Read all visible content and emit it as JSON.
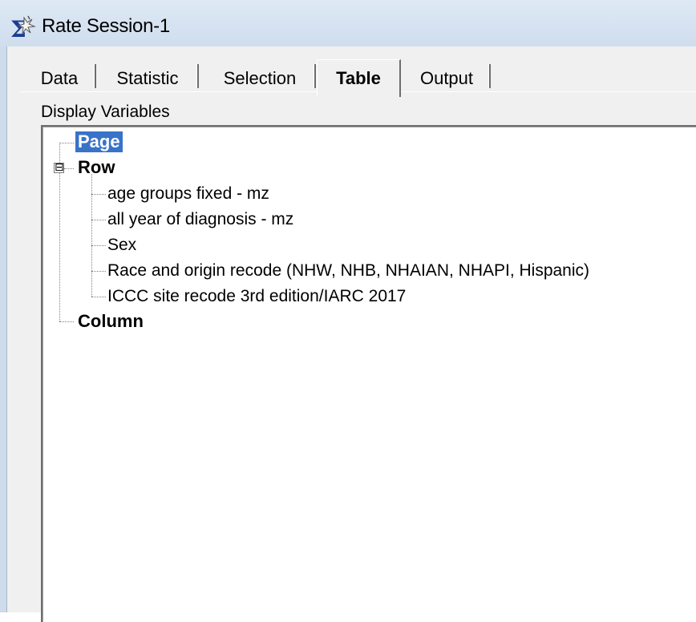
{
  "window": {
    "title": "Rate Session-1",
    "icon": "sigma-sparkle-icon"
  },
  "tabs": [
    {
      "label": "Data",
      "active": false
    },
    {
      "label": "Statistic",
      "active": false
    },
    {
      "label": "Selection",
      "active": false
    },
    {
      "label": "Table",
      "active": true
    },
    {
      "label": "Output",
      "active": false
    }
  ],
  "display_variables": {
    "label": "Display Variables",
    "tree": {
      "page": {
        "label": "Page",
        "selected": true
      },
      "row": {
        "label": "Row",
        "expander": "⊟",
        "children": [
          "age groups fixed - mz",
          "all year of diagnosis - mz",
          "Sex",
          "Race and origin recode (NHW, NHB, NHAIAN, NHAPI, Hispanic)",
          "ICCC site recode 3rd edition/IARC 2017"
        ]
      },
      "column": {
        "label": "Column"
      }
    }
  },
  "colors": {
    "selection": "#3873c9",
    "titlebar": "#dfe9f5",
    "dialog_bg": "#f0f0f0"
  }
}
